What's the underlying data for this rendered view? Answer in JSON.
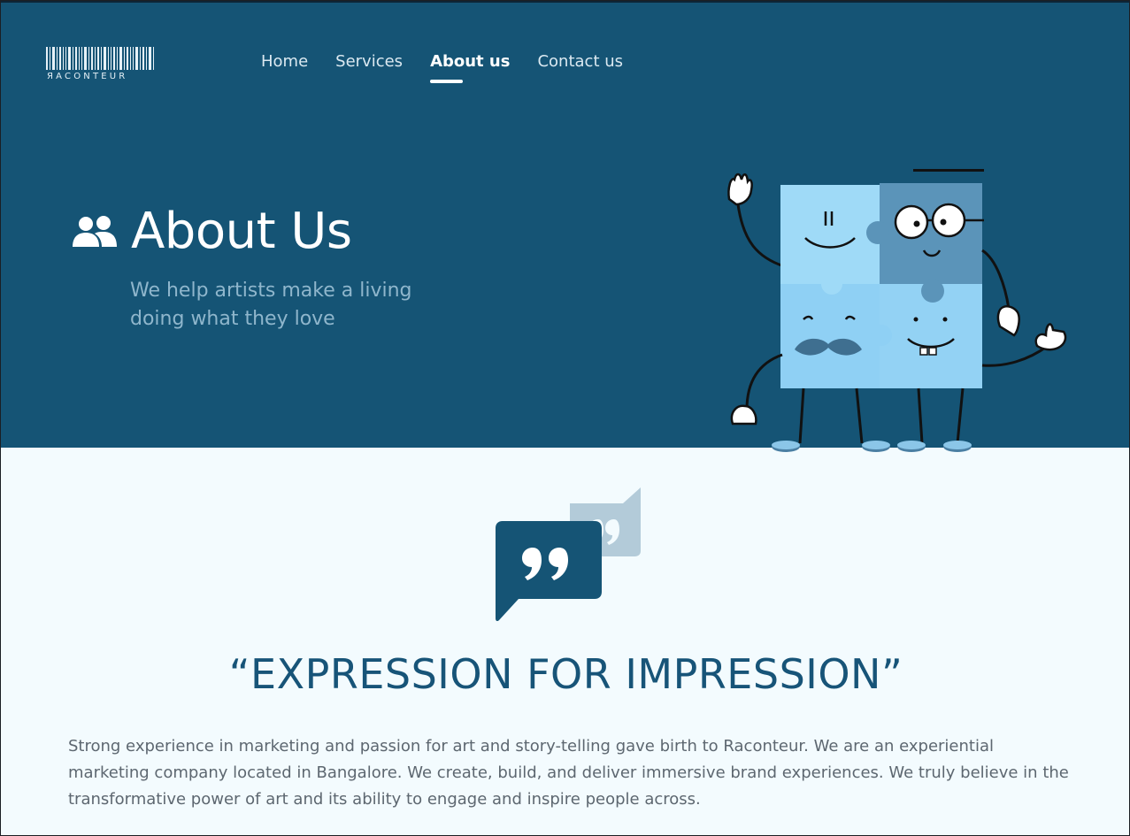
{
  "brand": {
    "logo_text": "ЯACONTEUR"
  },
  "nav": {
    "items": [
      {
        "label": "Home",
        "active": false
      },
      {
        "label": "Services",
        "active": false
      },
      {
        "label": "About us",
        "active": true
      },
      {
        "label": "Contact us",
        "active": false
      }
    ]
  },
  "hero": {
    "title": "About Us",
    "subtitle": "We help artists make a living doing what they love",
    "title_icon": "users-icon",
    "illustration": "puzzle-characters-illustration"
  },
  "quote": {
    "icon": "quote-bubbles-icon",
    "slogan": "“EXPRESSION FOR IMPRESSION”",
    "body": "Strong experience in marketing and passion for art and story-telling gave birth to Raconteur. We are an experiential marketing company located in Bangalore. We create, build, and deliver immersive brand experiences. We truly believe in the transformative power of art and its ability to engage and inspire people across."
  },
  "colors": {
    "hero_bg": "#155475",
    "page_bg": "#f3fbfe",
    "accent": "#175478",
    "subtitle": "#8fb6cc",
    "body_text": "#5d6770",
    "puzzle_light": "#8fd0f4",
    "puzzle_mid": "#5b94b9"
  }
}
